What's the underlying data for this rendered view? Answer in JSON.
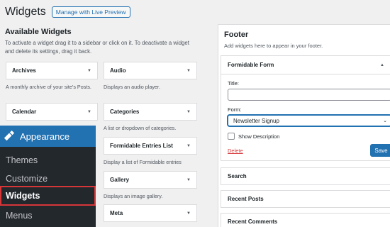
{
  "header": {
    "title": "Widgets",
    "preview_button": "Manage with Live Preview"
  },
  "available": {
    "title": "Available Widgets",
    "description": "To activate a widget drag it to a sidebar or click on it. To deactivate a widget and delete its settings, drag it back.",
    "widgets": [
      {
        "name": "Archives",
        "description": "A monthly archive of your site’s Posts."
      },
      {
        "name": "Audio",
        "description": "Displays an audio player."
      },
      {
        "name": "Calendar",
        "description": ""
      },
      {
        "name": "Categories",
        "description": "A list or dropdown of categories."
      },
      {
        "name": "Formidable Entries List",
        "description": "Display a list of Formidable entries"
      },
      {
        "name": "Gallery",
        "description": "Displays an image gallery."
      },
      {
        "name": "Meta",
        "description": ""
      }
    ]
  },
  "footer_area": {
    "title": "Footer",
    "description": "Add widgets here to appear in your footer.",
    "open_widget": {
      "name": "Formidable Form",
      "title_label": "Title:",
      "title_value": "",
      "form_label": "Form:",
      "form_selected": "Newsletter Signup",
      "show_description_label": "Show Description",
      "show_description_checked": false,
      "delete_label": "Delete",
      "save_label": "Save"
    }
  },
  "other_areas": [
    "Search",
    "Recent Posts",
    "Recent Comments"
  ],
  "admin_menu": {
    "section": "Appearance",
    "items": [
      "Themes",
      "Customize",
      "Widgets",
      "Menus"
    ],
    "current": "Widgets"
  },
  "colors": {
    "accent": "#2271b1",
    "menu_bg": "#23282d",
    "delete": "#d63638",
    "highlight_border": "#d63638"
  }
}
